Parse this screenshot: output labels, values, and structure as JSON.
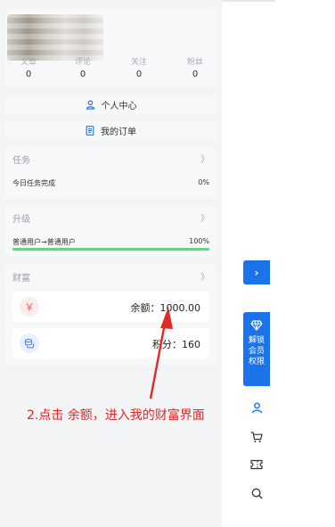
{
  "profile": {
    "stats": [
      {
        "label": "文章",
        "value": "0"
      },
      {
        "label": "评论",
        "value": "0"
      },
      {
        "label": "关注",
        "value": "0"
      },
      {
        "label": "粉丝",
        "value": "0"
      }
    ]
  },
  "menu": {
    "personal_center": "个人中心",
    "my_orders": "我的订单"
  },
  "task": {
    "title": "任务",
    "chevron": "》",
    "row_label": "今日任务完成",
    "row_value": "0%"
  },
  "upgrade": {
    "title": "升级",
    "chevron": "》",
    "row_label": "普通用户→普通用户",
    "row_value": "100%",
    "progress_fraction": 1.0
  },
  "wealth": {
    "title": "财富",
    "chevron": "》",
    "balance_label": "余额：1000.00",
    "points_label": "积分：160",
    "balance_icon": "yen-icon",
    "balance_symbol": "￥",
    "points_icon": "coins-icon"
  },
  "annotation": {
    "text": "2.点击 余额，进入我的财富界面"
  },
  "floating": {
    "collapse_symbol": "›",
    "vip_text_1": "解锁",
    "vip_text_2": "会员",
    "vip_text_3": "权限"
  },
  "colors": {
    "accent": "#1a73e8",
    "annotation": "#e02a2a",
    "progress": "#6fcf86"
  }
}
